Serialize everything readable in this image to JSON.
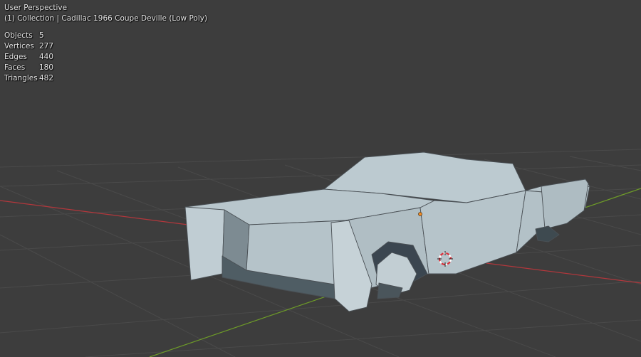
{
  "viewport": {
    "view_name": "User Perspective",
    "collection_info": "(1) Collection | Cadillac 1966 Coupe Deville (Low Poly)",
    "background_color": "#3d3d3d",
    "x_axis_color": "#b3373c",
    "y_axis_color": "#6e9c28",
    "grid_color": "#4a4a4a",
    "model_color": "#b4c2c8",
    "origin_color": "#f08a24"
  },
  "stats": [
    {
      "label": "Objects",
      "value": "5"
    },
    {
      "label": "Vertices",
      "value": "277"
    },
    {
      "label": "Edges",
      "value": "440"
    },
    {
      "label": "Faces",
      "value": "180"
    },
    {
      "label": "Triangles",
      "value": "482"
    }
  ],
  "icons": {
    "object_origin": "object-origin-icon",
    "cursor_3d": "3d-cursor-icon"
  }
}
